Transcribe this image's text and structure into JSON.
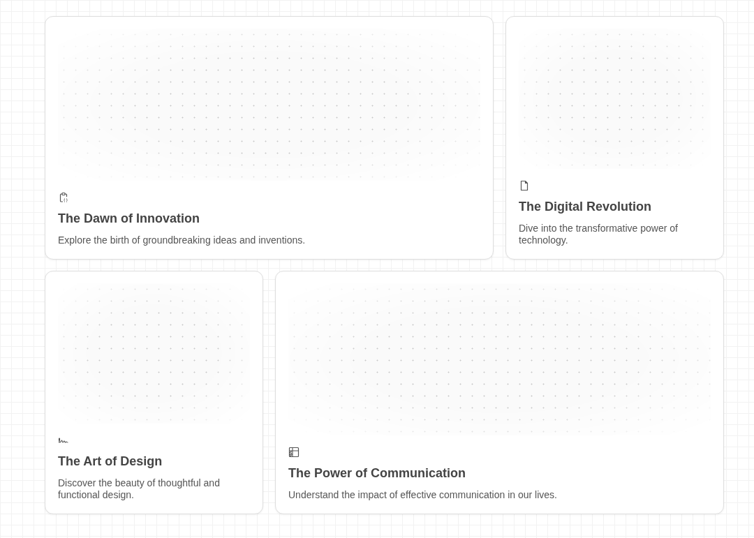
{
  "cards": [
    {
      "kind": "clipboard",
      "wide": true,
      "title": "The Dawn of Innovation",
      "description": "Explore the birth of groundbreaking ideas and inventions."
    },
    {
      "kind": "file",
      "wide": false,
      "title": "The Digital Revolution",
      "description": "Dive into the transformative power of technology."
    },
    {
      "kind": "signature",
      "wide": false,
      "title": "The Art of Design",
      "description": "Discover the beauty of thoughtful and functional design."
    },
    {
      "kind": "table",
      "wide": true,
      "title": "The Power of Communication",
      "description": "Understand the impact of effective communication in our lives."
    }
  ]
}
